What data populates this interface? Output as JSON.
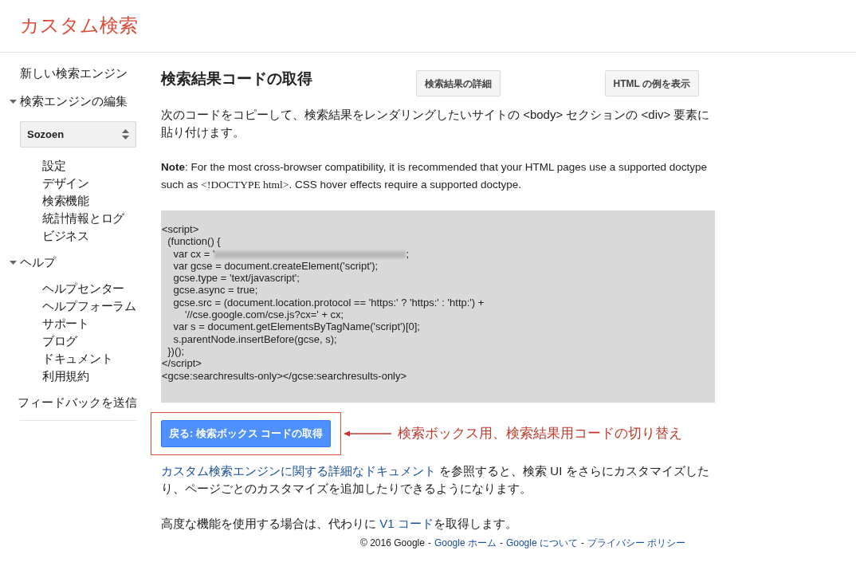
{
  "header": {
    "title": "カスタム検索"
  },
  "sidebar": {
    "items": [
      {
        "label": "新しい検索エンジン"
      },
      {
        "label": "検索エンジンの編集",
        "expanded": true,
        "select": {
          "value": "Sozoen"
        },
        "children": [
          {
            "label": "設定"
          },
          {
            "label": "デザイン"
          },
          {
            "label": "検索機能"
          },
          {
            "label": "統計情報とログ"
          },
          {
            "label": "ビジネス"
          }
        ]
      },
      {
        "label": "ヘルプ",
        "expanded": true,
        "children": [
          {
            "label": "ヘルプセンター"
          },
          {
            "label": "ヘルプフォーラム"
          },
          {
            "label": "サポート"
          },
          {
            "label": "ブログ"
          },
          {
            "label": "ドキュメント"
          },
          {
            "label": "利用規約"
          }
        ]
      },
      {
        "label": "フィードバックを送信"
      }
    ]
  },
  "main": {
    "title": "検索結果コードの取得",
    "buttons": [
      "検索結果の詳細",
      "HTML の例を表示"
    ],
    "intro": "次のコードをコピーして、検索結果をレンダリングしたいサイトの <body> セクションの <div> 要素に貼り付けます。",
    "note": [
      {
        "kind": "text",
        "text": "**Note**: For the most cross-browser compatibility, it is recommended that your HTML pages use a supported doctype such as "
      },
      {
        "kind": "serif",
        "text": "<!DOCTYPE html>"
      },
      {
        "kind": "text",
        "text": ". CSS hover effects require a supported doctype."
      }
    ],
    "code_lines": [
      {
        "kind": "text",
        "text": "<script>"
      },
      {
        "kind": "text",
        "text": "  (function() {"
      },
      {
        "kind": "redacted",
        "text": "    var cx = '",
        "after": ";"
      },
      {
        "kind": "text",
        "text": "    var gcse = document.createElement('script');"
      },
      {
        "kind": "text",
        "text": "    gcse.type = 'text/javascript';"
      },
      {
        "kind": "text",
        "text": "    gcse.async = true;"
      },
      {
        "kind": "text",
        "text": "    gcse.src = (document.location.protocol == 'https:' ? 'https:' : 'http:') +"
      },
      {
        "kind": "text",
        "text": "        '//cse.google.com/cse.js?cx=' + cx;"
      },
      {
        "kind": "text",
        "text": "    var s = document.getElementsByTagName('script')[0];"
      },
      {
        "kind": "text",
        "text": "    s.parentNode.insertBefore(gcse, s);"
      },
      {
        "kind": "text",
        "text": "  })();"
      },
      {
        "kind": "text",
        "text": "</script>"
      },
      {
        "kind": "text",
        "text": "<gcse:searchresults-only></gcse:searchresults-only>"
      }
    ],
    "back_button": "戻る: 検索ボックス コードの取得",
    "annotation": {
      "text": "検索ボックス用、検索結果用コードの切り替え"
    },
    "paragraphs": [
      [
        {
          "kind": "link",
          "text": "カスタム検索エンジンに関する詳細なドキュメント"
        },
        {
          "kind": "text",
          "text": " を参照すると、検索 UI をさらにカスタマイズしたり、ページごとのカスタマイズを追加したりできるようになります。"
        }
      ],
      [
        {
          "kind": "text",
          "text": "高度な機能を使用する場合は、代わりに "
        },
        {
          "kind": "link",
          "text": "V1 コード"
        },
        {
          "kind": "text",
          "text": "を取得します。"
        }
      ]
    ]
  },
  "footer": {
    "copyright": "© 2016 Google",
    "separator": "-",
    "links": [
      "Google ホーム",
      "Google について",
      "プライバシー ポリシー"
    ]
  }
}
